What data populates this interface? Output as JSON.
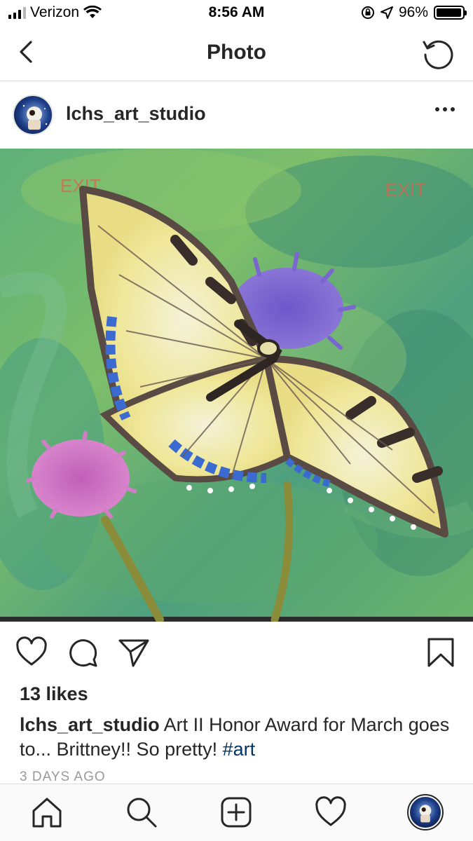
{
  "status_bar": {
    "carrier": "Verizon",
    "time": "8:56 AM",
    "battery_percent": "96%",
    "battery_level": 0.96
  },
  "nav": {
    "title": "Photo",
    "back_icon": "chevron-left-icon",
    "refresh_icon": "refresh-icon"
  },
  "post": {
    "username": "lchs_art_studio",
    "image_caption_accessible": "",
    "likes": "13 likes",
    "caption_user": "lchs_art_studio",
    "caption_text": "Art II Honor Award for March goes to... Brittney!! So pretty!",
    "hashtag": "#art",
    "time_ago": "3 DAYS AGO",
    "exit_sign_left": "EXIT",
    "exit_sign_right": "EXIT"
  },
  "colors": {
    "hashtag": "#003569",
    "text": "#262626",
    "muted": "#999999",
    "divider": "#dbdbdb"
  },
  "tabs": [
    {
      "name": "home",
      "icon": "home-icon"
    },
    {
      "name": "search",
      "icon": "search-icon"
    },
    {
      "name": "new-post",
      "icon": "plus-square-icon"
    },
    {
      "name": "activity",
      "icon": "heart-icon"
    },
    {
      "name": "profile",
      "icon": "avatar"
    }
  ]
}
